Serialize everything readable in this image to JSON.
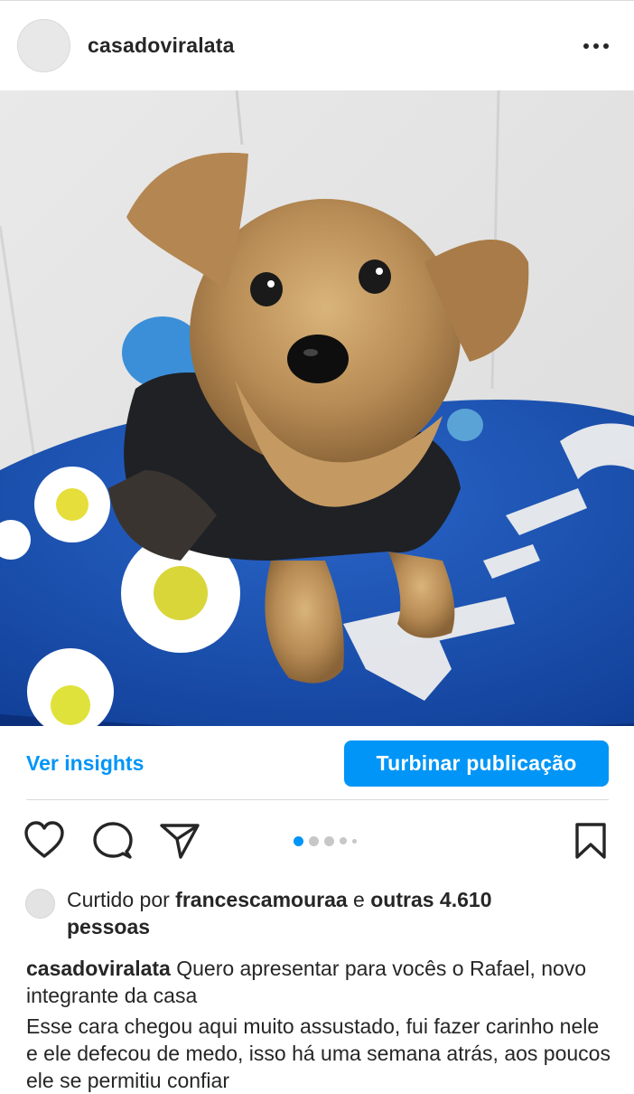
{
  "post": {
    "username": "casadoviralata",
    "more_icon": "more-horizontal-icon"
  },
  "actions": {
    "insights_label": "Ver insights",
    "boost_label": "Turbinar publicação"
  },
  "icons": {
    "like": "heart-icon",
    "comment": "comment-icon",
    "share": "send-icon",
    "save": "bookmark-icon"
  },
  "carousel": {
    "total": 5,
    "active_index": 0
  },
  "likes": {
    "prefix": "Curtido por ",
    "user": "francescamouraa",
    "connector": " e ",
    "others": "outras 4.610",
    "suffix": "pessoas"
  },
  "caption": {
    "username": "casadoviralata",
    "first_line": "Quero apresentar para vocês o Rafael, novo integrante da casa",
    "body": "Esse cara chegou aqui muito assustado, fui fazer carinho nele e ele defecou de medo, isso há uma semana atrás, aos poucos ele se permitiu confiar"
  },
  "colors": {
    "accent": "#0095f6",
    "text": "#262626",
    "divider": "#dbdbdb",
    "inactive_dot": "#c7c7c7"
  }
}
